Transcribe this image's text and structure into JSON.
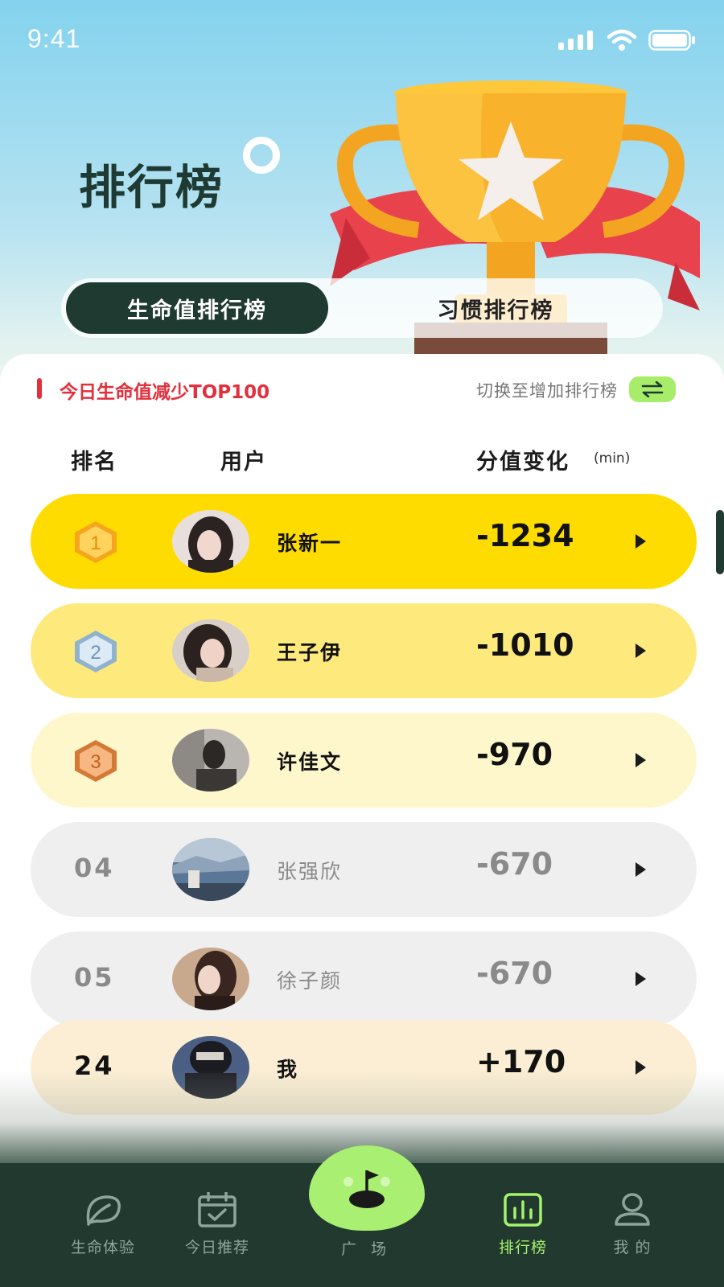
{
  "status": {
    "time": "9:41"
  },
  "header": {
    "title": "排行榜"
  },
  "tabs": [
    {
      "label": "生命值排行榜",
      "active": true
    },
    {
      "label": "习惯排行榜",
      "active": false
    }
  ],
  "list": {
    "title": "今日生命值减少TOP100",
    "switch_label": "切换至增加排行榜",
    "columns": {
      "rank": "排名",
      "user": "用户",
      "score": "分值变化",
      "unit": "(min)"
    }
  },
  "rows": [
    {
      "rank": "1",
      "name": "张新一",
      "score": "-1234",
      "bg": "#ffdc00"
    },
    {
      "rank": "2",
      "name": "王子伊",
      "score": "-1010",
      "bg": "#feea7c"
    },
    {
      "rank": "3",
      "name": "许佳文",
      "score": "-970",
      "bg": "#fff7cc"
    },
    {
      "rank": "04",
      "name": "张强欣",
      "score": "-670",
      "bg": "#efefef"
    },
    {
      "rank": "05",
      "name": "徐子颜",
      "score": "-670",
      "bg": "#efefef"
    },
    {
      "rank": "24",
      "name": "我",
      "score": "+170",
      "bg": "#fbeed4"
    }
  ],
  "nav": [
    {
      "label": "生命体验",
      "icon": "leaf-icon"
    },
    {
      "label": "今日推荐",
      "icon": "calendar-check-icon"
    },
    {
      "label": "广 场",
      "icon": "golf-flag-icon"
    },
    {
      "label": "排行榜",
      "icon": "bar-chart-icon",
      "active": true
    },
    {
      "label": "我 的",
      "icon": "user-icon"
    }
  ],
  "colors": {
    "accent_dark": "#1f3a30",
    "accent_green": "#a8ef72",
    "alert_red": "#e2303c"
  }
}
